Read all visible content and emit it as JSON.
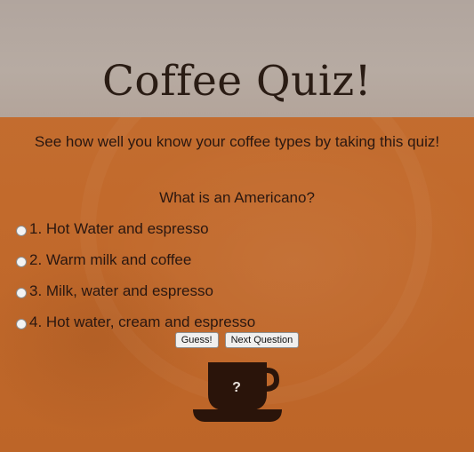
{
  "header": {
    "title": "Coffee Quiz!"
  },
  "intro": {
    "text": "See how well you know your coffee types by taking this quiz!"
  },
  "quiz": {
    "question": "What is an Americano?",
    "options": [
      {
        "label": "1. Hot Water and espresso",
        "selected": false
      },
      {
        "label": "2. Warm milk and coffee",
        "selected": false
      },
      {
        "label": "3. Milk, water and espresso",
        "selected": false
      },
      {
        "label": "4. Hot water, cream and espresso",
        "selected": false
      }
    ],
    "guess_label": "Guess!",
    "next_label": "Next Question"
  },
  "cup": {
    "icon": "coffee-cup-icon",
    "mark": "?"
  },
  "colors": {
    "background": "#c26a2c",
    "header": "#b7aba2",
    "text": "#2a1710",
    "cup": "#2a140a"
  }
}
